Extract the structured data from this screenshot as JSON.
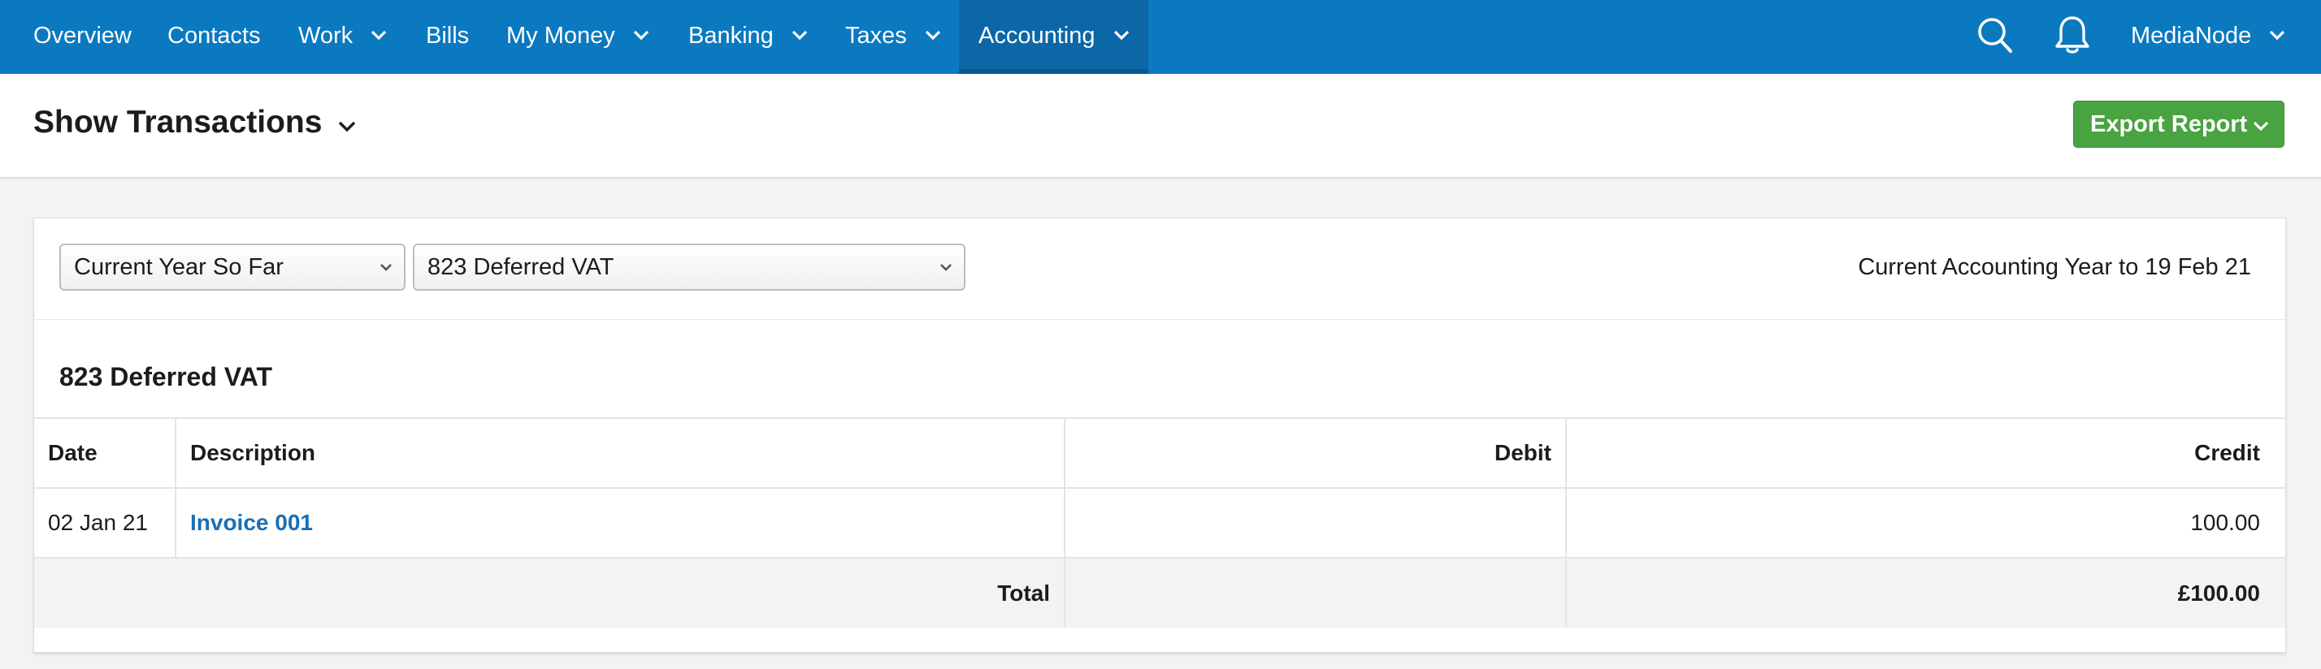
{
  "nav": {
    "items": [
      {
        "label": "Overview"
      },
      {
        "label": "Contacts"
      },
      {
        "label": "Work"
      },
      {
        "label": "Bills"
      },
      {
        "label": "My Money"
      },
      {
        "label": "Banking"
      },
      {
        "label": "Taxes"
      },
      {
        "label": "Accounting"
      }
    ],
    "active": "Accounting",
    "account_label": "MediaNode",
    "icons": [
      "search-icon",
      "bell-icon"
    ]
  },
  "header": {
    "title": "Show Transactions",
    "export_label": "Export Report"
  },
  "filters": {
    "period_value": "Current Year So Far",
    "account_value": "823 Deferred VAT",
    "period_description": "Current Accounting Year to 19 Feb 21"
  },
  "report": {
    "account_title": "823 Deferred VAT",
    "columns": {
      "date": "Date",
      "description": "Description",
      "debit": "Debit",
      "credit": "Credit"
    },
    "rows": [
      {
        "date": "02 Jan 21",
        "description": "Invoice 001",
        "debit": "",
        "credit": "100.00"
      }
    ],
    "total": {
      "label": "Total",
      "debit": "",
      "credit": "£100.00"
    }
  },
  "colors": {
    "nav_bg": "#0a79c0",
    "nav_active_bg": "#0c67a6",
    "export_button": "#48a340",
    "link": "#1a6fb5"
  }
}
